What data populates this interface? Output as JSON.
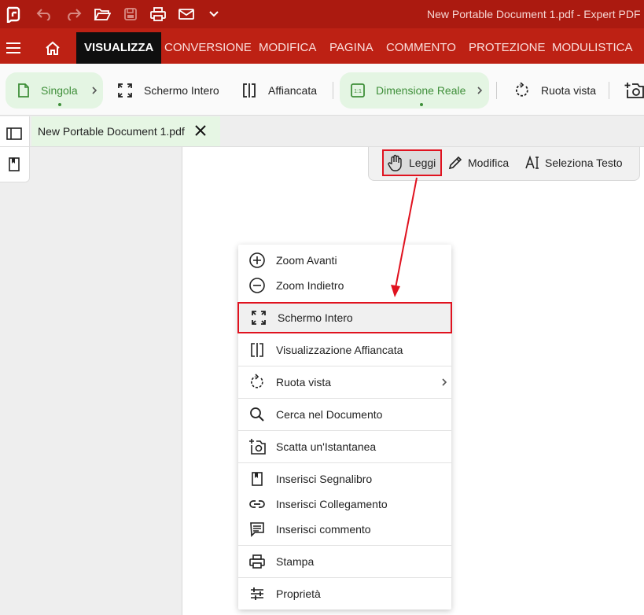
{
  "titlebar": {
    "title": "New Portable Document 1.pdf   -   Expert PDF",
    "icons": [
      "app-logo-icon",
      "undo-icon",
      "redo-icon",
      "open-folder-icon",
      "save-icon",
      "print-icon",
      "mail-icon",
      "chevron-down-icon"
    ]
  },
  "menubar": {
    "items": [
      "VISUALIZZA",
      "CONVERSIONE",
      "MODIFICA",
      "PAGINA",
      "COMMENTO",
      "PROTEZIONE",
      "MODULISTICA"
    ],
    "active": "VISUALIZZA"
  },
  "toolbar": {
    "single": "Singola",
    "fullscreen": "Schermo Intero",
    "side_by_side": "Affiancata",
    "actual_size": "Dimensione Reale",
    "rotate": "Ruota vista"
  },
  "tab": {
    "label": "New Portable Document 1.pdf"
  },
  "modes": {
    "read": "Leggi",
    "edit": "Modifica",
    "select_text": "Seleziona Testo"
  },
  "context_menu": {
    "items": [
      {
        "label": "Zoom Avanti",
        "icon": "zoom-in-icon"
      },
      {
        "label": "Zoom Indietro",
        "icon": "zoom-out-icon"
      },
      {
        "label": "Schermo Intero",
        "icon": "fullscreen-icon"
      },
      {
        "label": "Visualizzazione Affiancata",
        "icon": "side-by-side-icon"
      },
      {
        "label": "Ruota vista",
        "icon": "rotate-icon"
      },
      {
        "label": "Cerca nel Documento",
        "icon": "search-icon"
      },
      {
        "label": "Scatta un'Istantanea",
        "icon": "snapshot-icon"
      },
      {
        "label": "Inserisci Segnalibro",
        "icon": "bookmark-icon"
      },
      {
        "label": "Inserisci Collegamento",
        "icon": "link-icon"
      },
      {
        "label": "Inserisci commento",
        "icon": "comment-icon"
      },
      {
        "label": "Stampa",
        "icon": "print-icon"
      },
      {
        "label": "Proprietà",
        "icon": "properties-icon"
      }
    ],
    "highlighted": "Schermo Intero"
  },
  "colors": {
    "titlebar": "#ab1a10",
    "menubar": "#bd2114",
    "active_tab": "#0f0f0f",
    "accent_green": "#3f8f3a",
    "pill_green": "#e4f5e3",
    "annotation_red": "#e0121f"
  }
}
